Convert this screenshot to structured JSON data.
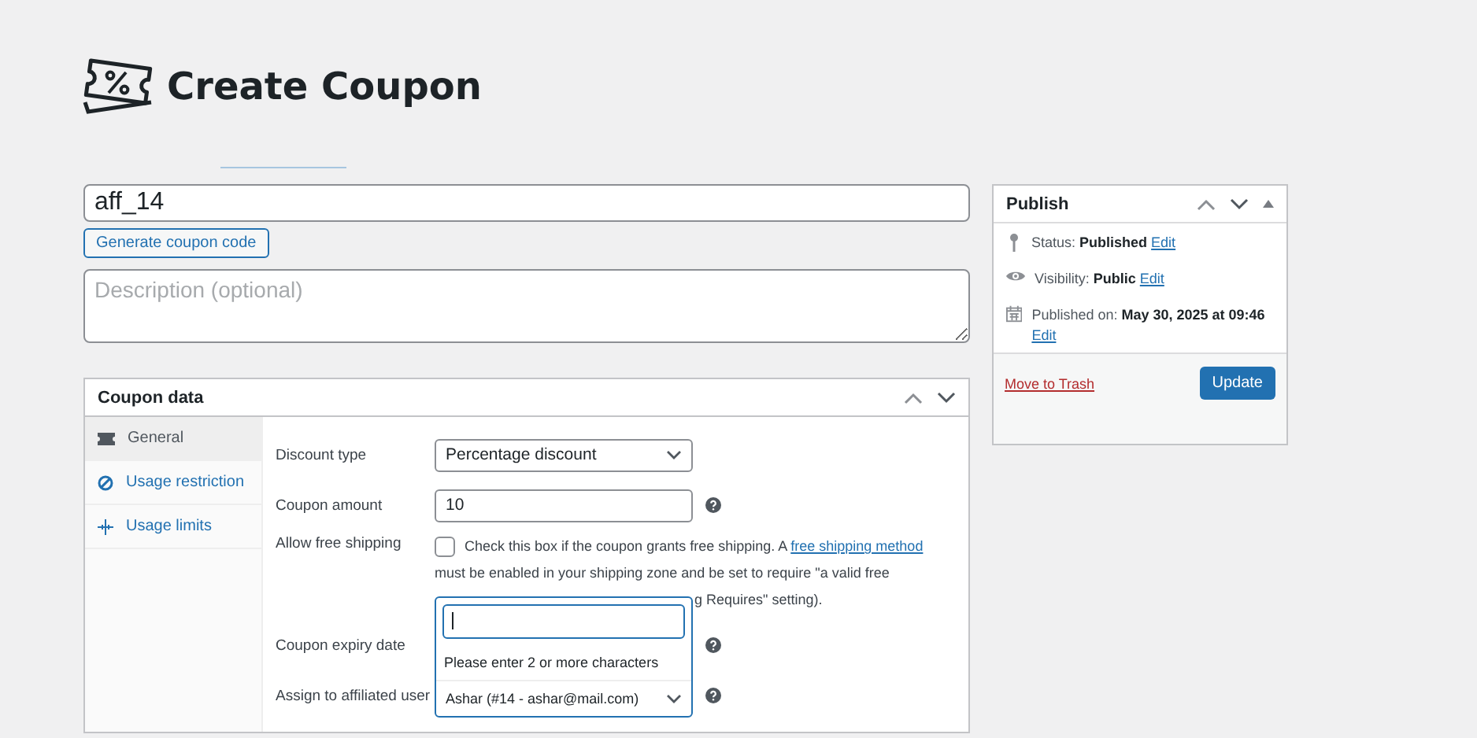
{
  "page": {
    "title": "Create Coupon"
  },
  "coupon_code": {
    "value": "aff_14"
  },
  "generate_button": "Generate coupon code",
  "description": {
    "placeholder": "Description (optional)"
  },
  "coupon_data": {
    "title": "Coupon data",
    "tabs": [
      {
        "label": "General",
        "selected": true
      },
      {
        "label": "Usage restriction",
        "selected": false
      },
      {
        "label": "Usage limits",
        "selected": false
      }
    ],
    "fields": [
      {
        "kind": "select",
        "label": "Discount type",
        "value": "Percentage discount"
      },
      {
        "kind": "input",
        "label": "Coupon amount",
        "value": "10",
        "help": true
      },
      {
        "kind": "checkbox",
        "label": "Allow free shipping",
        "checked": false,
        "text": "Check this box if the coupon grants free shipping. A ",
        "link": "free shipping method",
        "line2": "must be enabled in your shipping zone and be set to require \"a valid free",
        "line3": "g Requires\" setting)."
      },
      {
        "kind": "covered",
        "label": "Coupon expiry date",
        "help": true
      },
      {
        "kind": "search_select",
        "label": "Assign to affiliated user",
        "value": "Ashar (#14 - ashar@mail.com)",
        "help": true,
        "message": "Please enter 2 or more characters"
      }
    ]
  },
  "publish": {
    "title": "Publish",
    "rows": [
      {
        "label": "Status: ",
        "value": "Published",
        "link": "Edit"
      },
      {
        "label": "Visibility: ",
        "value": "Public",
        "link": "Edit"
      },
      {
        "label": "Published on: ",
        "value": "May 30, 2025 at 09:46",
        "link": "Edit"
      }
    ],
    "trash": "Move to Trash",
    "update": "Update"
  }
}
